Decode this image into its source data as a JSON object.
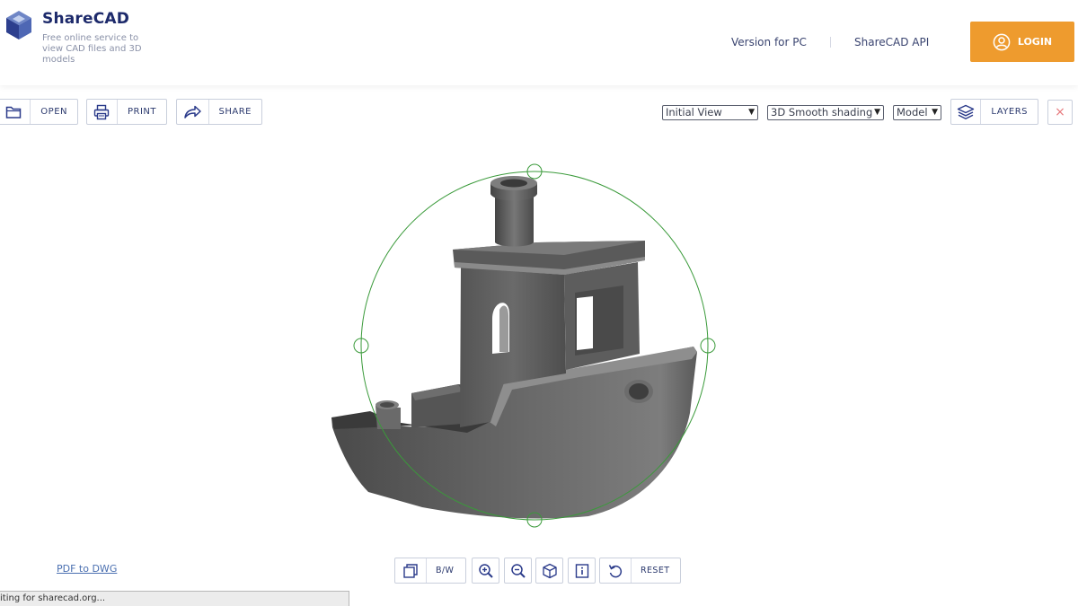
{
  "header": {
    "brand": "ShareCAD",
    "tagline": "Free online service to view CAD files and 3D models",
    "nav": [
      {
        "label": "Version for PC"
      },
      {
        "label": "ShareCAD API"
      }
    ],
    "login_label": "LOGIN"
  },
  "toolbar": {
    "open_label": "OPEN",
    "print_label": "PRINT",
    "share_label": "SHARE",
    "view_select": "Initial View",
    "shading_select": "3D Smooth shading",
    "model_select": "Model",
    "layers_label": "LAYERS",
    "close_symbol": "×"
  },
  "bottom": {
    "pdf_link": "PDF to DWG",
    "bw_label": "B/W",
    "reset_label": "RESET",
    "status_text": "iting for sharecad.org..."
  },
  "colors": {
    "brand": "#1d2a6b",
    "accent": "#ee9b2e",
    "orbit": "#3a9a3a",
    "close": "#e7787c"
  }
}
